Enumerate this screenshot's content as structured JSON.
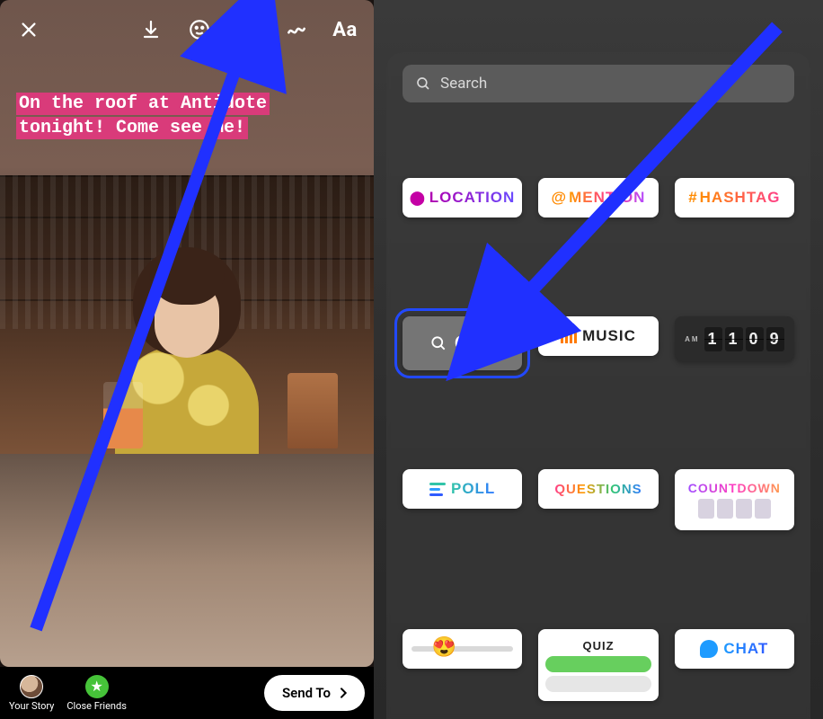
{
  "left": {
    "toolbar": {
      "close": "close",
      "download": "download",
      "face": "face-filter",
      "sticker": "sticker",
      "draw": "draw",
      "text_label": "Aa"
    },
    "caption_line1": "On the roof at Antidote",
    "caption_line2": "tonight! Come see me!",
    "bottom": {
      "your_story": "Your Story",
      "close_friends": "Close Friends",
      "send_to": "Send To"
    }
  },
  "right": {
    "search_placeholder": "Search",
    "stickers": {
      "location": "LOCATION",
      "mention": "MENTION",
      "hashtag": "HASHTAG",
      "gif": "GIF",
      "music": "MUSIC",
      "time_am": "AM",
      "time_digits": [
        "1",
        "1",
        "0",
        "9"
      ],
      "poll": "POLL",
      "questions": "QUESTIONS",
      "countdown": "COUNTDOWN",
      "quiz": "QUIZ",
      "chat": "CHAT"
    }
  }
}
